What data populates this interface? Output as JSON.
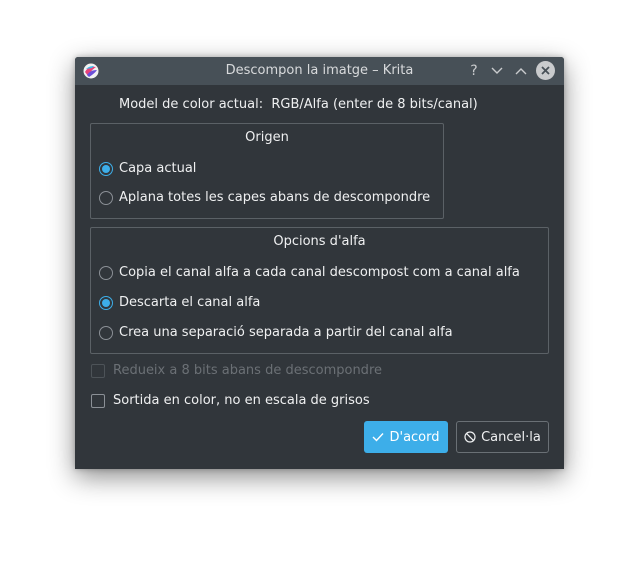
{
  "window": {
    "title": "Descompon la imatge – Krita",
    "controls": {
      "help": "?",
      "minimize": "chevron-down",
      "maximize": "chevron-up",
      "close": "close"
    }
  },
  "model_line": "Model de color actual:  RGB/Alfa (enter de 8 bits/canal)",
  "origin_group": {
    "title": "Origen",
    "options": [
      {
        "label": "Capa actual",
        "selected": true
      },
      {
        "label": "Aplana totes les capes abans de descompondre",
        "selected": false
      }
    ]
  },
  "alpha_group": {
    "title": "Opcions d'alfa",
    "options": [
      {
        "label": "Copia el canal alfa a cada canal descompost com a canal alfa",
        "selected": false
      },
      {
        "label": "Descarta el canal alfa",
        "selected": true
      },
      {
        "label": "Crea una separació separada a partir del canal alfa",
        "selected": false
      }
    ]
  },
  "checkboxes": [
    {
      "label": "Redueix a 8 bits abans de descompondre",
      "checked": false,
      "enabled": false
    },
    {
      "label": "Sortida en color, no en escala de grisos",
      "checked": false,
      "enabled": true
    }
  ],
  "buttons": {
    "ok": "D'acord",
    "cancel": "Cancel·la"
  },
  "colors": {
    "window_bg": "#31363b",
    "titlebar_bg": "#475057",
    "accent": "#3daee9",
    "text": "#eff0f1",
    "disabled_text": "#6b7075"
  }
}
